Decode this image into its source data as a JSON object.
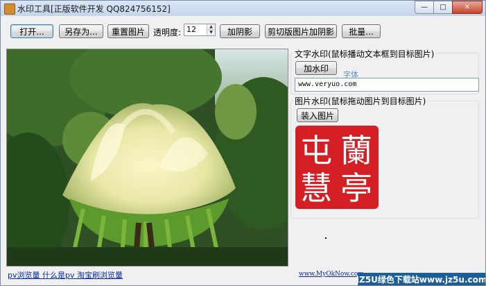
{
  "window": {
    "title": "水印工具[正版软件开发 QQ824756152]",
    "min_glyph": "—",
    "max_glyph": "□",
    "close_glyph": "✕"
  },
  "toolbar": {
    "open_label": "打开...",
    "save_as_label": "另存为...",
    "reset_label": "重置图片",
    "opacity_label": "透明度:",
    "opacity_value": "12",
    "add_shadow_label": "加阴影",
    "cut_shadow_label": "剪切版图片加阴影",
    "batch_label": "批量..."
  },
  "text_watermark": {
    "group_title": "文字水印(鼠标播动文本框到目标图片)",
    "add_button": "加水印",
    "font_link": "字体",
    "text_value": "www.veryuo.com"
  },
  "image_watermark": {
    "group_title": "图片水印(鼠标拖动图片到目标图片)",
    "load_button": "装入图片",
    "seal_chars": [
      "蘭",
      "亭",
      "屯",
      "慧"
    ]
  },
  "footer": {
    "left_link": "pv浏览量 什么是pv 淘宝刷浏览量",
    "mid_link": "www.MyOkNow.com",
    "watermark": "JZ5U绿色下载站www.jz5u.com"
  },
  "colors": {
    "seal_red": "#d41f24",
    "link_blue": "#0a2aa8",
    "titlebar_top": "#dbe6f4"
  }
}
